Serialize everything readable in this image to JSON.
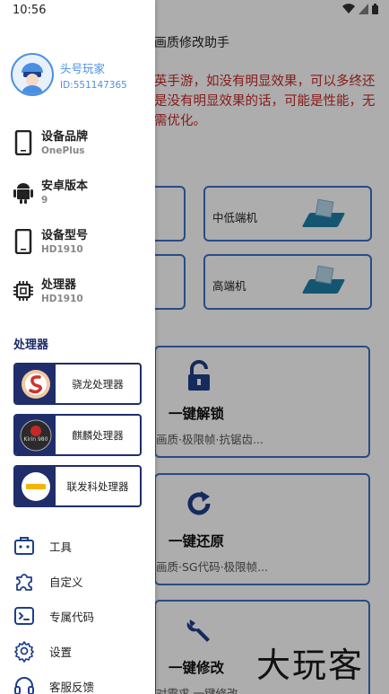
{
  "status_bar": {
    "time": "10:56"
  },
  "main": {
    "title": "画质修改助手",
    "warning": "英手游，如没有明显效果，可以多终还是没有明显效果的话，可能是性能，无需优化。",
    "tiers": [
      {
        "label": "中低端机"
      },
      {
        "label": "高端机"
      }
    ],
    "actions": [
      {
        "title": "一键解锁",
        "subtitle": "画质·极限帧·抗锯齿..."
      },
      {
        "title": "一键还原",
        "subtitle": "画质·SG代码·极限帧..."
      },
      {
        "title": "一键修改",
        "subtitle": "对需求 一键修改"
      }
    ],
    "watermark": "大玩客"
  },
  "drawer": {
    "user": {
      "name": "头号玩家",
      "id": "ID:551147365"
    },
    "device_info": [
      {
        "label": "设备品牌",
        "value": "OnePlus",
        "icon": "phone-icon"
      },
      {
        "label": "安卓版本",
        "value": "9",
        "icon": "android-icon"
      },
      {
        "label": "设备型号",
        "value": "HD1910",
        "icon": "phone-icon"
      },
      {
        "label": "处理器",
        "value": "HD1910",
        "icon": "chip-icon"
      }
    ],
    "processor_section": "处理器",
    "processors": [
      {
        "label": "骁龙处理器",
        "logo": "snapdragon-logo"
      },
      {
        "label": "麒麟处理器",
        "logo": "kirin-logo"
      },
      {
        "label": "联发科处理器",
        "logo": "mediatek-logo"
      }
    ],
    "menu": [
      {
        "label": "工具",
        "icon": "toolbox-icon"
      },
      {
        "label": "自定义",
        "icon": "puzzle-icon"
      },
      {
        "label": "专属代码",
        "icon": "terminal-icon"
      },
      {
        "label": "设置",
        "icon": "gear-icon"
      },
      {
        "label": "客服反馈",
        "icon": "headset-icon"
      }
    ]
  },
  "colors": {
    "accent_blue": "#4a90e2",
    "card_border": "#3d6fc4",
    "processor_navy": "#1f2d6b",
    "warning_red": "#c62828"
  }
}
